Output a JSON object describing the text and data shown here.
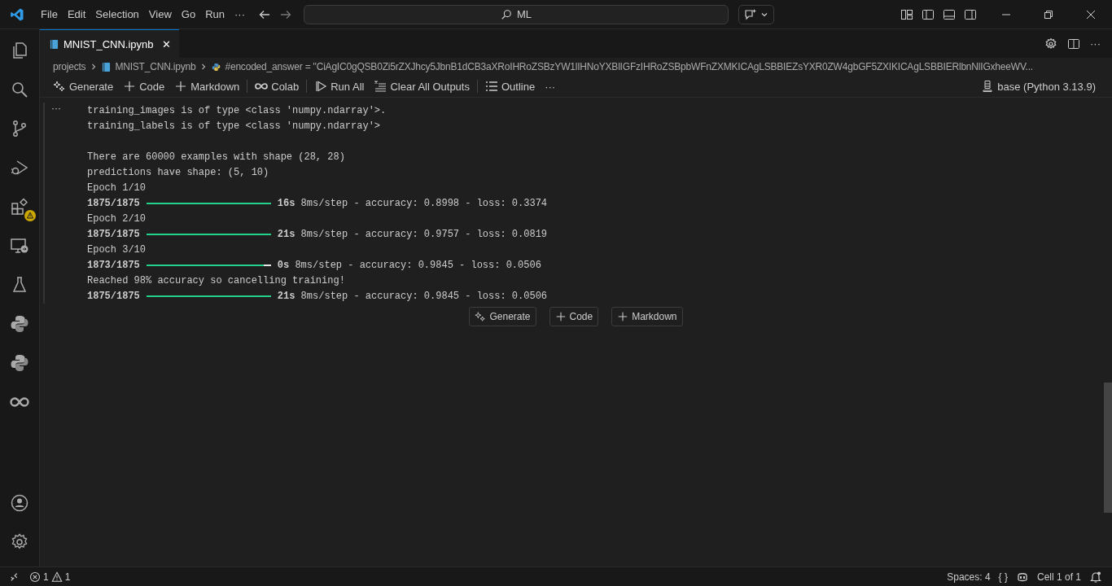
{
  "menu": [
    "File",
    "Edit",
    "Selection",
    "View",
    "Go",
    "Run",
    "···"
  ],
  "search": {
    "value": "ML"
  },
  "tab": {
    "title": "MNIST_CNN.ipynb",
    "close": "✕"
  },
  "breadcrumb": [
    "projects",
    "MNIST_CNN.ipynb",
    "#encoded_answer = \"CiAgIC0gQSB0Zi5rZXJhcy5JbnB1dCB3aXRoIHRoZSBzYW1lIHNoYXBlIGFzIHRoZSBpbWFnZXMKICAgLSBBIEZsYXR0ZW4gbGF5ZXIKICAgLSBBIERlbnNlIGxheeWV..."
  ],
  "toolbar": [
    {
      "kind": "sparkle",
      "label": "Generate"
    },
    {
      "kind": "plus",
      "label": "Code"
    },
    {
      "kind": "plus",
      "label": "Markdown"
    },
    {
      "kind": "sep"
    },
    {
      "kind": "infinity",
      "label": "Colab"
    },
    {
      "kind": "sep"
    },
    {
      "kind": "run",
      "label": "Run All"
    },
    {
      "kind": "clear",
      "label": "Clear All Outputs"
    },
    {
      "kind": "sep"
    },
    {
      "kind": "list",
      "label": "Outline"
    },
    {
      "kind": "more",
      "label": "···"
    }
  ],
  "kernel": "base (Python 3.13.9)",
  "output_menu": "···",
  "output": [
    {
      "kind": "text",
      "text": "training_images is of type <class 'numpy.ndarray'>."
    },
    {
      "kind": "text",
      "text": "training_labels is of type <class 'numpy.ndarray'>"
    },
    {
      "kind": "blank"
    },
    {
      "kind": "text",
      "text": "There are 60000 examples with shape (28, 28)"
    },
    {
      "kind": "text",
      "text": "predictions have shape: (5, 10)"
    },
    {
      "kind": "text",
      "text": "Epoch 1/10"
    },
    {
      "kind": "progress",
      "steps": "1875/1875",
      "level": 1,
      "time": "16s",
      "rest": "8ms/step - accuracy: 0.8998 - loss: 0.3374"
    },
    {
      "kind": "text",
      "text": "Epoch 2/10"
    },
    {
      "kind": "progress",
      "steps": "1875/1875",
      "level": 1,
      "time": "21s",
      "rest": "8ms/step - accuracy: 0.9757 - loss: 0.0819"
    },
    {
      "kind": "text",
      "text": "Epoch 3/10"
    },
    {
      "kind": "progress",
      "steps": "1873/1875",
      "level": 0.94,
      "time": "0s",
      "rest": "8ms/step - accuracy: 0.9845 - loss: 0.0506"
    },
    {
      "kind": "text",
      "text": "Reached 98% accuracy so cancelling training!"
    },
    {
      "kind": "progress",
      "steps": "1875/1875",
      "level": 1,
      "time": "21s",
      "rest": "8ms/step - accuracy: 0.9845 - loss: 0.0506"
    }
  ],
  "add_cell": [
    {
      "kind": "sparkle",
      "label": "Generate"
    },
    {
      "kind": "plus",
      "label": "Code"
    },
    {
      "kind": "plus",
      "label": "Markdown"
    }
  ],
  "status": {
    "errors": "1",
    "warnings": "1",
    "spaces": "Spaces: 4",
    "braces": "{ }",
    "cell": "Cell 1 of 1"
  }
}
